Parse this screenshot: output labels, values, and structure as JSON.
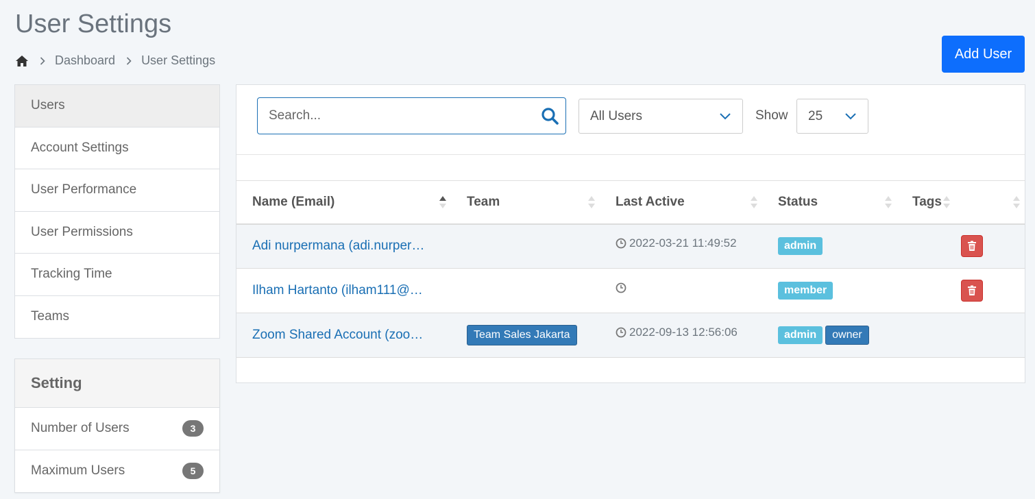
{
  "header": {
    "title": "User Settings",
    "add_user_label": "Add User"
  },
  "breadcrumb": {
    "home_icon": "home-icon",
    "items": [
      "Dashboard",
      "User Settings"
    ]
  },
  "sidebar": {
    "items": [
      {
        "label": "Users",
        "active": true
      },
      {
        "label": "Account Settings"
      },
      {
        "label": "User Performance"
      },
      {
        "label": "User Permissions"
      },
      {
        "label": "Tracking Time"
      },
      {
        "label": "Teams"
      }
    ]
  },
  "setting": {
    "title": "Setting",
    "items": [
      {
        "label": "Number of Users",
        "count": "3"
      },
      {
        "label": "Maximum Users",
        "count": "5"
      }
    ]
  },
  "toolbar": {
    "search_placeholder": "Search...",
    "filter_value": "All Users",
    "show_label": "Show",
    "show_value": "25"
  },
  "table": {
    "columns": [
      "Name (Email)",
      "Team",
      "Last Active",
      "Status",
      "Tags"
    ],
    "rows": [
      {
        "name": "Adi nurpermana (adi.nurper…",
        "team": "",
        "last_active": "2022-03-21 11:49:52",
        "statuses": [
          "admin"
        ],
        "deletable": true
      },
      {
        "name": "Ilham Hartanto (ilham111@…",
        "team": "",
        "last_active": "",
        "statuses": [
          "member"
        ],
        "deletable": true
      },
      {
        "name": "Zoom Shared Account (zoo…",
        "team": "Team Sales Jakarta",
        "last_active": "2022-09-13 12:56:06",
        "statuses": [
          "admin",
          "owner"
        ],
        "deletable": false
      }
    ]
  },
  "colors": {
    "primary": "#0d6efd",
    "link": "#1a6fb4",
    "badge_info": "#5bc0de",
    "badge_primary": "#337ab7",
    "danger": "#d9534f"
  }
}
